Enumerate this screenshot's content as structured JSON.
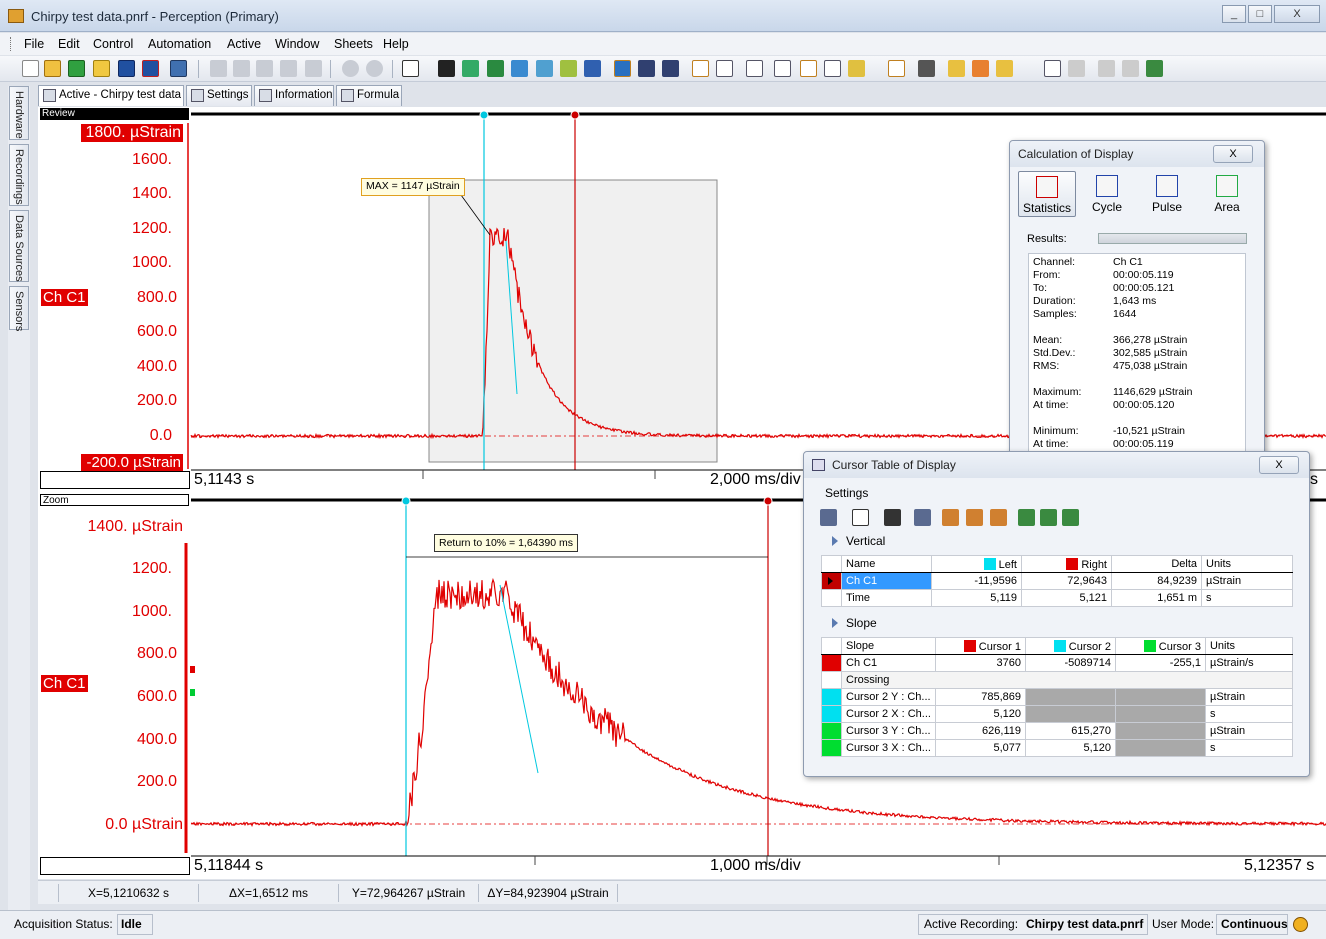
{
  "window": {
    "title": "Chirpy test data.pnrf - Perception (Primary)",
    "min": "_",
    "max": "□",
    "close": "X"
  },
  "menu": [
    "File",
    "Edit",
    "Control",
    "Automation",
    "Active",
    "Window",
    "Sheets",
    "Help"
  ],
  "vtabs": [
    "Hardware",
    "Recordings",
    "Data Sources",
    "Sensors"
  ],
  "tabs": [
    {
      "label": "Active - Chirpy test data",
      "icon": "sheet-icon"
    },
    {
      "label": "Settings",
      "icon": "settings-icon"
    },
    {
      "label": "Information",
      "icon": "info-icon"
    },
    {
      "label": "Formula",
      "icon": "formula-icon"
    }
  ],
  "review": {
    "label": "Review",
    "channel": "Ch C1",
    "yticks": [
      "1800.  µStrain",
      "1600.",
      "1400.",
      "1200.",
      "1000.",
      "800.0",
      "600.0",
      "400.0",
      "200.0",
      "0.0",
      "-200.0 µStrain"
    ],
    "x_start": "5,1143 s",
    "x_div": "2,000 ms/div",
    "x_end_partial": "s",
    "annotation": "MAX = 1147 µStrain"
  },
  "zoom": {
    "label": "Zoom",
    "channel": "Ch C1",
    "yticks": [
      "1400.  µStrain",
      "1200.",
      "1000.",
      "800.0",
      "600.0",
      "400.0",
      "200.0",
      "0.0  µStrain"
    ],
    "x_start": "5,11844 s",
    "x_div": "1,000 ms/div",
    "x_end": "5,12357 s",
    "annotation": "Return to 10% =  1,64390 ms"
  },
  "colors": {
    "trace": "#e00000",
    "cursor_left": "#00c8e0",
    "cursor_right": "#cc0000",
    "cursor_3": "#00cc33"
  },
  "calc": {
    "title": "Calculation of Display",
    "close": "X",
    "tabs": [
      "Statistics",
      "Cycle",
      "Pulse",
      "Area"
    ],
    "results_label": "Results:",
    "rows": [
      {
        "k": "Channel:",
        "v": "Ch C1"
      },
      {
        "k": "From:",
        "v": "00:00:05.119"
      },
      {
        "k": "To:",
        "v": "00:00:05.121"
      },
      {
        "k": "Duration:",
        "v": "1,643 ms"
      },
      {
        "k": "Samples:",
        "v": "1644"
      },
      {
        "k": "Mean:",
        "v": "366,278 µStrain"
      },
      {
        "k": "Std.Dev.:",
        "v": "302,585 µStrain"
      },
      {
        "k": "RMS:",
        "v": "475,038 µStrain"
      },
      {
        "k": "Maximum:",
        "v": "1146,629 µStrain"
      },
      {
        "k": "At time:",
        "v": "00:00:05.120"
      },
      {
        "k": "Minimum:",
        "v": "-10,521 µStrain"
      },
      {
        "k": "At time:",
        "v": "00:00:05.119"
      }
    ]
  },
  "cursor_table": {
    "title": "Cursor Table of Display",
    "close": "X",
    "settings": "Settings",
    "vertical_label": "Vertical",
    "vertical_headers": [
      "Name",
      "Left",
      "Right",
      "Delta",
      "Units"
    ],
    "vertical_rows": [
      [
        "Ch C1",
        "-11,9596",
        "72,9643",
        "84,9239",
        "µStrain"
      ],
      [
        "Time",
        "5,119",
        "5,121",
        "1,651 m",
        "s"
      ]
    ],
    "slope_label": "Slope",
    "slope_headers": [
      "Slope",
      "Cursor 1",
      "Cursor 2",
      "Cursor 3",
      "Units"
    ],
    "slope_rows": [
      [
        "Ch C1",
        "3760",
        "-5089714",
        "-255,1",
        "µStrain/s"
      ]
    ],
    "crossing_label": "Crossing",
    "crossing_rows": [
      [
        "Cursor 2 Y : Ch...",
        "785,869",
        "",
        "",
        "µStrain"
      ],
      [
        "Cursor 2 X : Ch...",
        "5,120",
        "",
        "",
        "s"
      ],
      [
        "Cursor 3 Y : Ch...",
        "626,119",
        "615,270",
        "",
        "µStrain"
      ],
      [
        "Cursor 3 X : Ch...",
        "5,077",
        "5,120",
        "",
        "s"
      ]
    ]
  },
  "cursorbar": [
    "X=5,1210632 s",
    "ΔX=1,6512 ms",
    "Y=72,964267 µStrain",
    "ΔY=84,923904 µStrain"
  ],
  "status": {
    "acq_label": "Acquisition Status:",
    "acq_value": "Idle",
    "rec_label": "Active Recording:",
    "rec_value": "Chirpy test data.pnrf",
    "mode_label": "User Mode:",
    "mode_value": "Continuous"
  }
}
